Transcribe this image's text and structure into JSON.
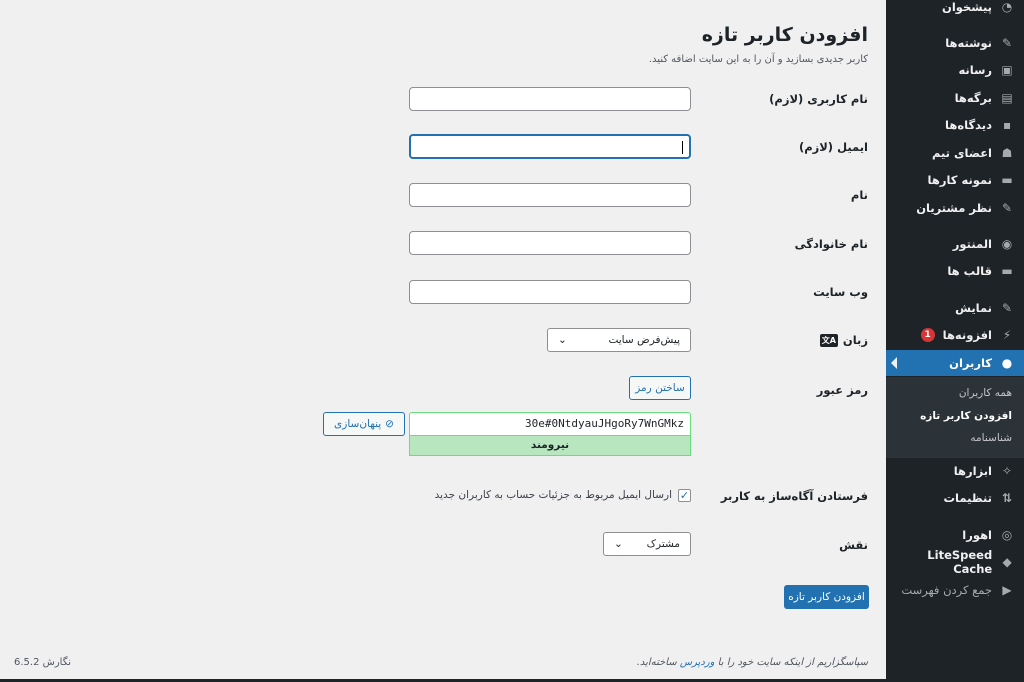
{
  "sidebar": {
    "items": [
      {
        "label": "پیشخوان",
        "icon": "dashboard-icon"
      },
      {
        "label": "نوشته‌ها",
        "icon": "pin-icon"
      },
      {
        "label": "رسانه",
        "icon": "media-icon"
      },
      {
        "label": "برگه‌ها",
        "icon": "pages-icon"
      },
      {
        "label": "دیدگاه‌ها",
        "icon": "comment-icon"
      },
      {
        "label": "اعضای تیم",
        "icon": "team-icon"
      },
      {
        "label": "نمونه کارها",
        "icon": "folder-icon"
      },
      {
        "label": "نظر مشتریان",
        "icon": "pin-icon"
      },
      {
        "label": "المنتور",
        "icon": "elementor-icon"
      },
      {
        "label": "قالب ها",
        "icon": "folder-icon"
      },
      {
        "label": "نمایش",
        "icon": "appearance-icon"
      },
      {
        "label": "افزونه‌ها",
        "icon": "plugin-icon",
        "badge": "1"
      },
      {
        "label": "کاربران",
        "icon": "user-icon",
        "active": true
      },
      {
        "label": "ابزارها",
        "icon": "wrench-icon"
      },
      {
        "label": "تنظیمات",
        "icon": "settings-icon"
      },
      {
        "label": "اهورا",
        "icon": "ahura-icon"
      },
      {
        "label": "LiteSpeed Cache",
        "icon": "litespeed-icon"
      },
      {
        "label": "جمع کردن فهرست",
        "icon": "collapse-icon"
      }
    ],
    "submenu": [
      "همه کاربران",
      "افزودن کاربر تازه",
      "شناسنامه"
    ]
  },
  "page": {
    "title": "افزودن کاربر تازه",
    "subtitle": "کاربر جدیدی بسازید و آن را به این سایت اضافه کنید."
  },
  "form": {
    "username_label": "نام کاربری (لازم)",
    "email_label": "ایمیل (لازم)",
    "first_name_label": "نام",
    "last_name_label": "نام خانوادگی",
    "website_label": "وب سایت",
    "language_label": "زبان",
    "language_value": "پیش‌فرض سایت",
    "password_label": "رمز عبور",
    "generate_label": "ساختن رمز",
    "password_value": "30e#0NtdyauJHgoRy7WnGMkz",
    "hide_label": "پنهان‌سازی",
    "strength": "نیرومند",
    "notify_label": "فرستادن آگاه‌ساز به کاربر",
    "notify_text": "ارسال ایمیل مربوط به جزئیات حساب به کاربران جدید",
    "notify_checked": true,
    "role_label": "نقش",
    "role_value": "مشترک",
    "submit_label": "افزودن کاربر تازه"
  },
  "footer": {
    "thanks_pre": "سپاسگزاریم از اینکه سایت خود را با ",
    "thanks_link": "وردپرس",
    "thanks_post": " ساخته‌اید.",
    "version": "نگارش 6.5.2"
  },
  "colors": {
    "accent": "#2271b1",
    "sidebar": "#1d2327",
    "strong": "#b8e6bf"
  }
}
